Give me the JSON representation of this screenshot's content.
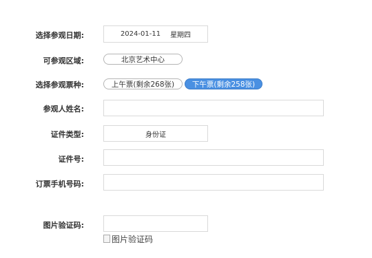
{
  "form": {
    "visit_date": {
      "label": "选择参观日期:",
      "date": "2024-01-11",
      "weekday": "星期四"
    },
    "area": {
      "label": "可参观区域:",
      "options": [
        "北京艺术中心"
      ]
    },
    "ticket": {
      "label": "选择参观票种:",
      "options": [
        {
          "text": "上午票(剩余268张)",
          "selected": false
        },
        {
          "text": "下午票(剩余258张)",
          "selected": true
        }
      ]
    },
    "name": {
      "label": "参观人姓名:",
      "value": ""
    },
    "id_type": {
      "label": "证件类型:",
      "value": "身份证"
    },
    "id_number": {
      "label": "证件号:",
      "value": ""
    },
    "phone": {
      "label": "订票手机号码:",
      "value": ""
    },
    "captcha": {
      "label": "图片验证码:",
      "value": "",
      "image_alt": "图片验证码"
    }
  },
  "colors": {
    "accent": "#4a90e2",
    "border": "#d9d9d9"
  }
}
